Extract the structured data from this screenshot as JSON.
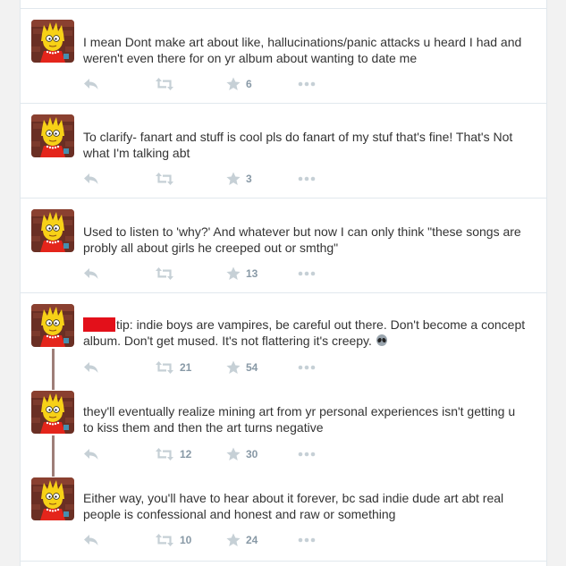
{
  "colors": {
    "text": "#333333",
    "action_icon": "#c6d0d6",
    "count": "#8899a6",
    "redaction": "#e3101a",
    "thread_line": "#9e7e78",
    "divider": "#e1e8ed"
  },
  "tweets": [
    {
      "line1": "I mean Dont make art about like,  hallucinations/panic attacks u heard I had and",
      "line2": "weren't even there for on yr album about wanting to date me",
      "retweets": "",
      "likes": "6"
    },
    {
      "line1": "To clarify- fanart and stuff is cool pls do fanart of my stuf that's fine! That's Not",
      "line2": "what I'm talking abt",
      "retweets": "",
      "likes": "3"
    },
    {
      "line1": "Used to listen to 'why?' And whatever but now I can only think \"these songs are",
      "line2": "probly all about girls he creeped out or smthg\"",
      "retweets": "",
      "likes": "13"
    },
    {
      "line1": "tip: indie boys are vampires, be careful out there. Don't become a concept",
      "line2": "album. Don't get mused. It's not flattering it's creepy.",
      "emoji": "alien-emoji",
      "retweets": "21",
      "likes": "54"
    },
    {
      "line1": "they'll eventually realize mining art from yr personal experiences isn't getting u",
      "line2": "to kiss them and then the art turns negative",
      "retweets": "12",
      "likes": "30"
    },
    {
      "line1": "Either way, you'll have to hear about it forever, bc sad indie dude art abt real",
      "line2": "people is confessional and honest and raw or something",
      "retweets": "10",
      "likes": "24"
    }
  ]
}
